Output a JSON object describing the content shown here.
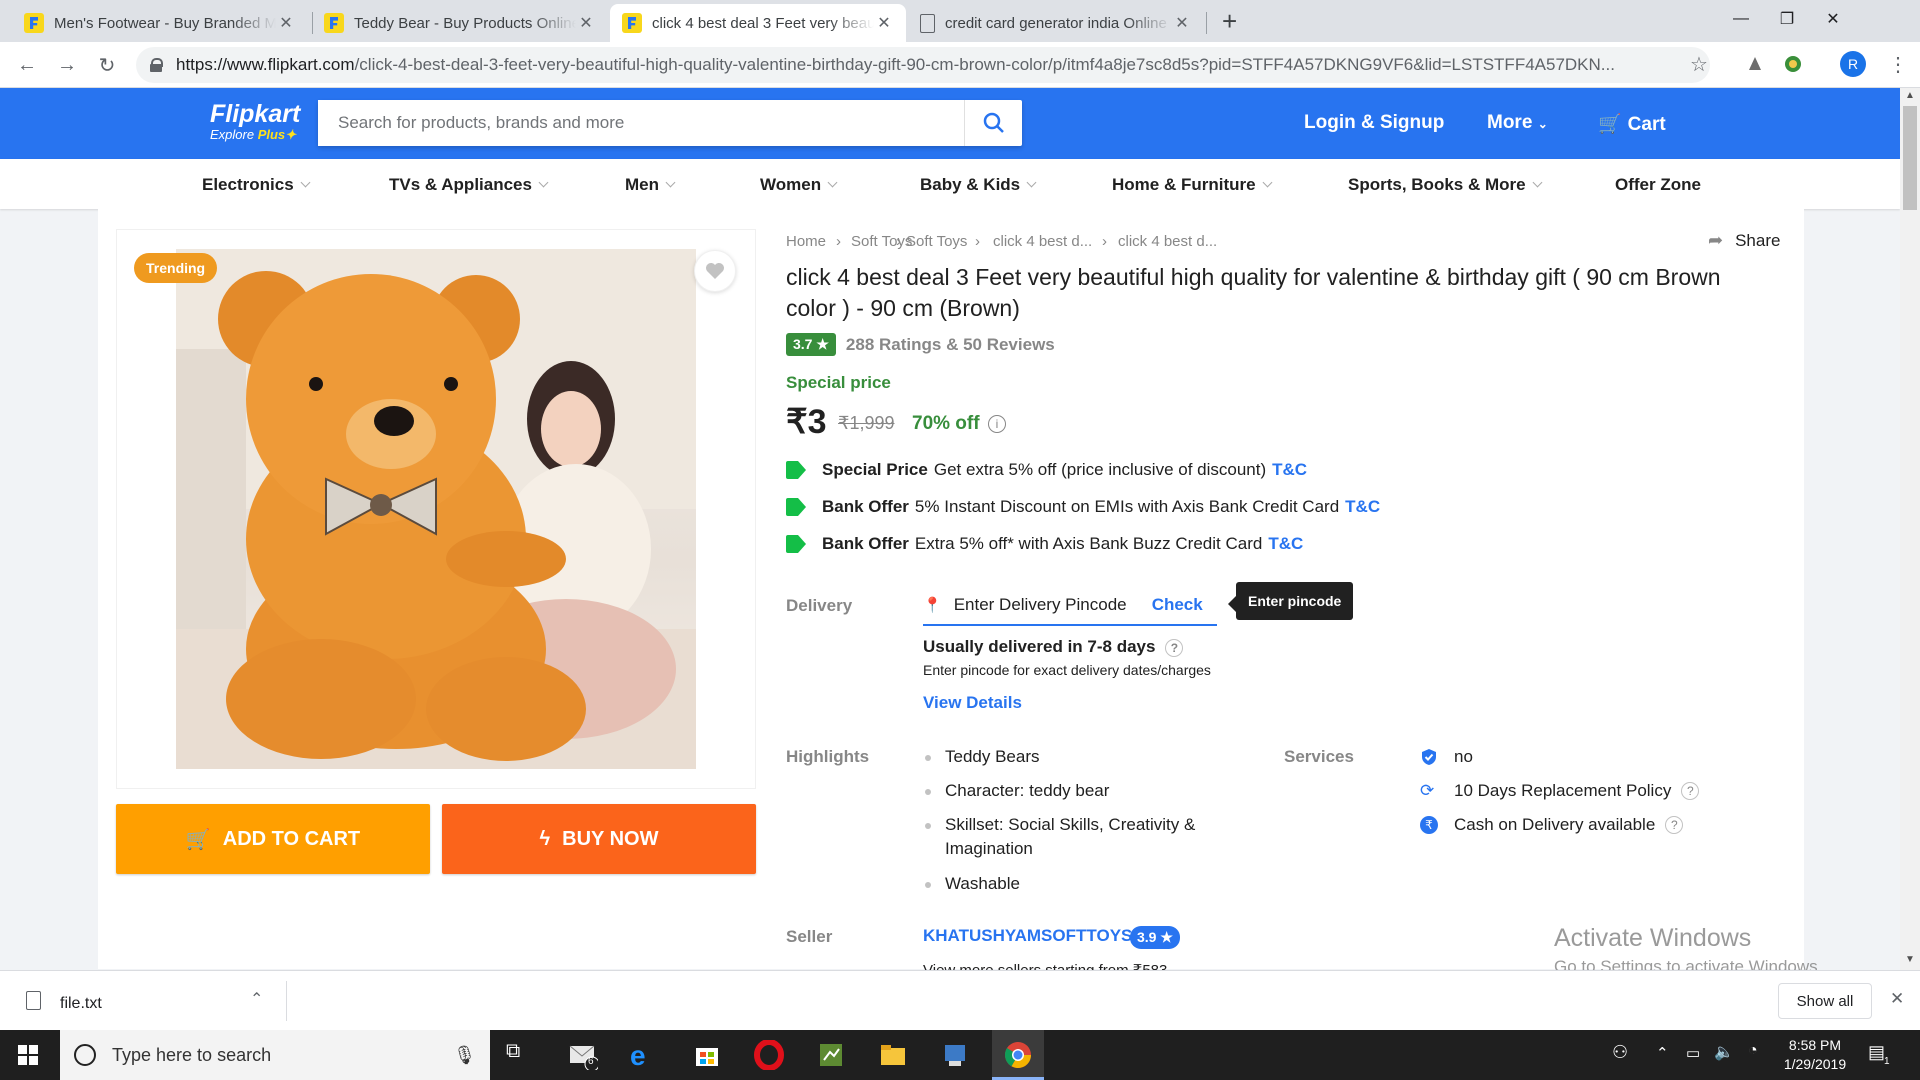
{
  "browser": {
    "tabs": [
      {
        "title": "Men's Footwear - Buy Branded M",
        "active": false,
        "icon": "flipkart-favicon"
      },
      {
        "title": "Teddy Bear - Buy Products Online",
        "active": false,
        "icon": "flipkart-favicon"
      },
      {
        "title": "click 4 best deal 3 Feet very beau",
        "active": true,
        "icon": "flipkart-favicon"
      },
      {
        "title": "credit card generator india Online",
        "active": false,
        "icon": "document-icon"
      }
    ],
    "url_host": "https://www.flipkart.com",
    "url_path": "/click-4-best-deal-3-feet-very-beautiful-high-quality-valentine-birthday-gift-90-cm-brown-color/p/itmf4a8je7sc8d5s?pid=STFF4A57DKNG9VF6&lid=LSTSTFF4A57DKN...",
    "profile_initial": "R"
  },
  "header": {
    "brand": "Flipkart",
    "tagline": "Explore",
    "tagline_plus": "Plus",
    "search_placeholder": "Search for products, brands and more",
    "login": "Login & Signup",
    "more": "More",
    "cart": "Cart",
    "brand_color": "#2874f0"
  },
  "categories": [
    "Electronics",
    "TVs & Appliances",
    "Men",
    "Women",
    "Baby & Kids",
    "Home & Furniture",
    "Sports, Books & More",
    "Offer Zone"
  ],
  "product": {
    "badge": "Trending",
    "breadcrumbs": [
      "Home",
      "Soft Toys",
      "click 4 best d...",
      "click 4 best d..."
    ],
    "share": "Share",
    "title": "click 4 best deal 3 Feet very beautiful high quality for valentine & birthday gift ( 90 cm Brown color ) - 90 cm  (Brown)",
    "rating": "3.7",
    "rating_text": "288 Ratings & 50 Reviews",
    "special_price_label": "Special price",
    "price": "₹3",
    "mrp": "₹1,999",
    "discount": "70% off",
    "add_to_cart": "ADD TO CART",
    "buy_now": "BUY NOW"
  },
  "offers": [
    {
      "type": "Special Price",
      "text": "Get extra 5% off (price inclusive of discount)",
      "tc": "T&C"
    },
    {
      "type": "Bank Offer",
      "text": "5% Instant Discount on EMIs with Axis Bank Credit Card",
      "tc": "T&C"
    },
    {
      "type": "Bank Offer",
      "text": "Extra 5% off* with Axis Bank Buzz Credit Card",
      "tc": "T&C"
    }
  ],
  "delivery": {
    "label": "Delivery",
    "pincode_placeholder": "Enter Delivery Pincode",
    "check": "Check",
    "tooltip": "Enter pincode",
    "eta": "Usually delivered in 7-8 days",
    "note": "Enter pincode for exact delivery dates/charges",
    "view_details": "View Details"
  },
  "highlights": {
    "label": "Highlights",
    "items": [
      "Teddy Bears",
      "Character: teddy bear",
      "Skillset: Social Skills, Creativity &",
      "Imagination",
      "Washable"
    ]
  },
  "services": {
    "label": "Services",
    "items": [
      "no",
      "10 Days Replacement Policy",
      "Cash on Delivery available"
    ]
  },
  "seller": {
    "label": "Seller",
    "name": "KHATUSHYAMSOFTTOYS",
    "rating": "3.9",
    "more": "View more sellers starting from ₹583"
  },
  "watermark": {
    "line1": "Activate Windows",
    "line2": "Go to Settings to activate Windows."
  },
  "download": {
    "file": "file.txt",
    "show_all": "Show all"
  },
  "taskbar": {
    "search_placeholder": "Type here to search",
    "time": "8:58 PM",
    "date": "1/29/2019",
    "mail_badge": "6",
    "notif_badge": "1"
  }
}
